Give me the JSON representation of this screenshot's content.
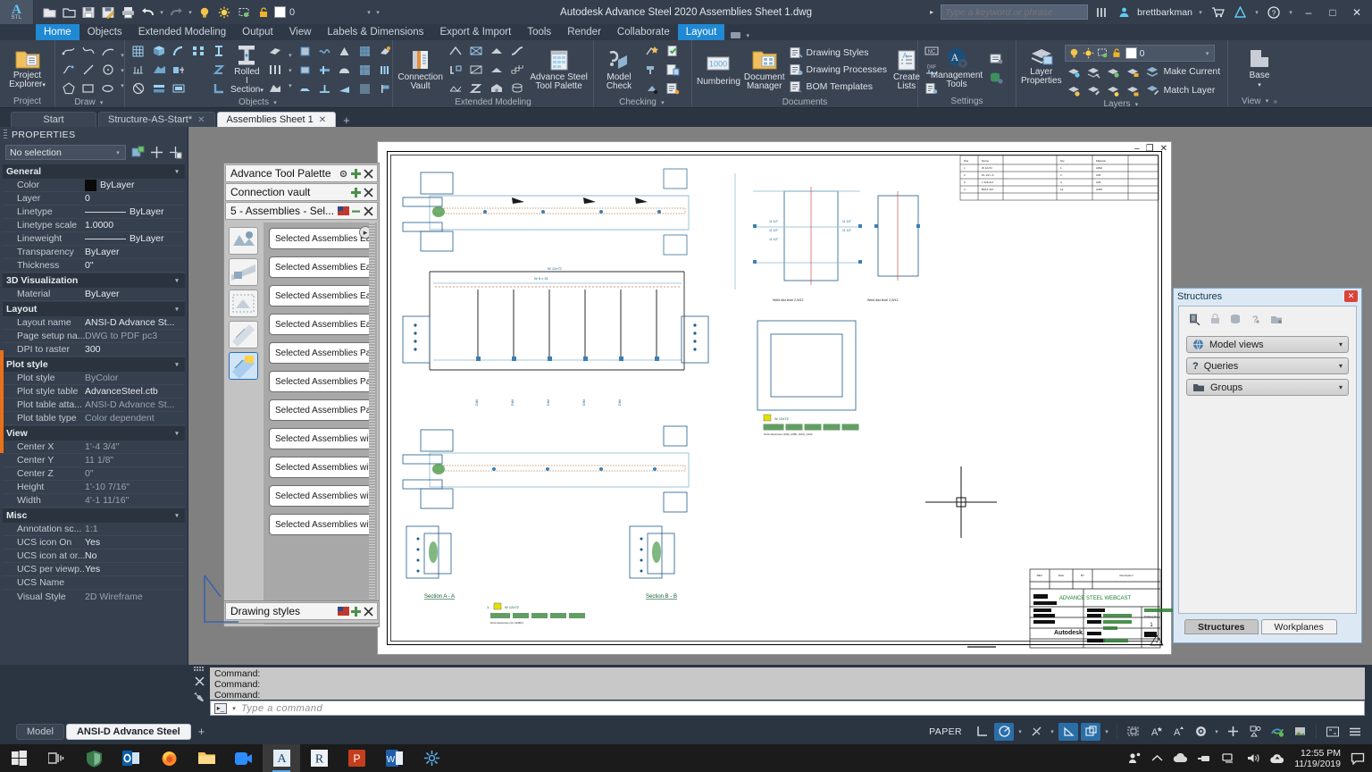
{
  "window": {
    "title": "Autodesk Advance Steel 2020   Assemblies Sheet 1.dwg",
    "app_initials": "STL",
    "search_placeholder": "Type a keyword or phrase",
    "user": "brettbarkman",
    "layer_current": "0",
    "min_label": "–",
    "max_label": "□",
    "close_label": "✕"
  },
  "ribbon": {
    "tabs": [
      {
        "label": "Home",
        "active": true
      },
      {
        "label": "Objects",
        "active": false
      },
      {
        "label": "Extended Modeling",
        "active": false
      },
      {
        "label": "Output",
        "active": false
      },
      {
        "label": "View",
        "active": false
      },
      {
        "label": "Labels & Dimensions",
        "active": false
      },
      {
        "label": "Export & Import",
        "active": false
      },
      {
        "label": "Tools",
        "active": false
      },
      {
        "label": "Render",
        "active": false
      },
      {
        "label": "Collaborate",
        "active": false
      },
      {
        "label": "Layout",
        "active": true
      }
    ],
    "panels": [
      {
        "title": "Project",
        "big": [
          {
            "label": "Project\nExplorer"
          }
        ]
      },
      {
        "title": "Draw"
      },
      {
        "title": "Objects",
        "big": [
          {
            "label": "Rolled\nI Section"
          }
        ]
      },
      {
        "title": "Extended Modeling",
        "big": [
          {
            "label": "Connection\nVault"
          },
          {
            "label": "Advance Steel\nTool Palette"
          }
        ]
      },
      {
        "title": "Checking",
        "big": [
          {
            "label": "Model\nCheck"
          }
        ]
      },
      {
        "title": "Documents",
        "big": [
          {
            "label": "Numbering"
          },
          {
            "label": "Document\nManager"
          },
          {
            "label": "Create\nLists"
          }
        ],
        "rows": [
          "Drawing Styles",
          "Drawing Processes",
          "BOM Templates"
        ]
      },
      {
        "title": "Settings",
        "big": [
          {
            "label": "Management\nTools"
          }
        ]
      },
      {
        "title": "Layers",
        "big": [
          {
            "label": "Layer\nProperties"
          }
        ],
        "rows": [
          "Make Current",
          "Match Layer"
        ]
      },
      {
        "title": "View",
        "big": [
          {
            "label": "Base"
          }
        ]
      }
    ]
  },
  "doc_tabs": [
    {
      "label": "Start",
      "active": false,
      "closable": false
    },
    {
      "label": "Structure-AS-Start*",
      "active": false,
      "closable": true
    },
    {
      "label": "Assemblies Sheet 1",
      "active": true,
      "closable": true
    }
  ],
  "properties": {
    "title": "PROPERTIES",
    "selection": "No selection",
    "groups": [
      {
        "name": "General",
        "rows": [
          {
            "key": "Color",
            "value": "ByLayer",
            "swatch": "#0a0a0a"
          },
          {
            "key": "Layer",
            "value": "0"
          },
          {
            "key": "Linetype",
            "value": "ByLayer",
            "line": true
          },
          {
            "key": "Linetype scale",
            "value": "1.0000"
          },
          {
            "key": "Lineweight",
            "value": "ByLayer",
            "line": true
          },
          {
            "key": "Transparency",
            "value": "ByLayer"
          },
          {
            "key": "Thickness",
            "value": "0\""
          }
        ]
      },
      {
        "name": "3D Visualization",
        "rows": [
          {
            "key": "Material",
            "value": "ByLayer"
          }
        ]
      },
      {
        "name": "Layout",
        "rows": [
          {
            "key": "Layout name",
            "value": "ANSI-D Advance St..."
          },
          {
            "key": "Page setup na...",
            "value": "DWG to PDF pc3",
            "dim": true
          },
          {
            "key": "DPI to raster",
            "value": "300"
          }
        ]
      },
      {
        "name": "Plot style",
        "rows": [
          {
            "key": "Plot style",
            "value": "ByColor",
            "dim": true
          },
          {
            "key": "Plot style table",
            "value": "AdvanceSteel.ctb"
          },
          {
            "key": "Plot table atta...",
            "value": "ANSI-D Advance St...",
            "dim": true
          },
          {
            "key": "Plot table type",
            "value": "Color dependent",
            "dim": true
          }
        ]
      },
      {
        "name": "View",
        "rows": [
          {
            "key": "Center X",
            "value": "1'-4 3/4\"",
            "dim": true
          },
          {
            "key": "Center Y",
            "value": "11 1/8\"",
            "dim": true
          },
          {
            "key": "Center Z",
            "value": "0\"",
            "dim": true
          },
          {
            "key": "Height",
            "value": "1'-10 7/16\"",
            "dim": true
          },
          {
            "key": "Width",
            "value": "4'-1 11/16\"",
            "dim": true
          }
        ]
      },
      {
        "name": "Misc",
        "rows": [
          {
            "key": "Annotation sc...",
            "value": "1:1",
            "dim": true
          },
          {
            "key": "UCS icon On",
            "value": "Yes"
          },
          {
            "key": "UCS icon at or...",
            "value": "No"
          },
          {
            "key": "UCS per viewp...",
            "value": "Yes"
          },
          {
            "key": "UCS Name",
            "value": ""
          },
          {
            "key": "Visual Style",
            "value": "2D Wireframe",
            "dim": true
          }
        ]
      }
    ]
  },
  "tool_palette": {
    "titles": [
      {
        "label": "Advance Tool Palette",
        "icons": [
          "gear-icon",
          "move-icon",
          "close-icon"
        ]
      },
      {
        "label": "Connection vault",
        "icons": [
          "move-icon",
          "close-icon"
        ]
      },
      {
        "label": "5 - Assemblies - Sel...",
        "icons": [
          "flag-icon",
          "minimize-icon",
          "close-icon"
        ]
      }
    ],
    "items": [
      "Selected Assemblies Ea...",
      "Selected Assemblies Each AN...",
      "Selected Assemblies Each AN...",
      "Selected Assemblies Each AN...",
      "Selected Assemblies PageF...",
      "Selected Assemblies PageF...",
      "Selected Assemblies PageF...",
      "Selected Assemblies with Par...",
      "Selected Assemblies with Par...",
      "Selected Assemblies with Par...",
      "Selected Assemblies with Par..."
    ],
    "drawing_styles_label": "Drawing styles"
  },
  "structures": {
    "title": "Structures",
    "close_label": "✕",
    "bars": [
      {
        "label": "Model views",
        "icon": "globe-icon"
      },
      {
        "label": "Queries",
        "icon": "question-icon"
      },
      {
        "label": "Groups",
        "icon": "folder-icon"
      }
    ],
    "tabs": [
      {
        "label": "Structures",
        "active": true
      },
      {
        "label": "Workplanes",
        "active": false
      }
    ]
  },
  "drawing": {
    "title_block": {
      "rev_headers": [
        "REV.",
        "Date",
        "BY",
        "Description"
      ],
      "project_title": "ADVANCE STEEL WEBCAST",
      "brand": "Autodesk.",
      "drawing_no_label": "Drawing No. :",
      "drawing_no": "1"
    },
    "section_labels": [
      "Section A - A",
      "Section B - B"
    ]
  },
  "command_line": {
    "history": [
      "Command:",
      "Command:",
      "Command:"
    ],
    "placeholder": "Type a command"
  },
  "status_bar": {
    "layout_tabs": [
      {
        "label": "Model",
        "active": false
      },
      {
        "label": "ANSI-D Advance Steel",
        "active": true
      }
    ],
    "add_label": "+",
    "space_label": "PAPER"
  },
  "taskbar": {
    "icons": [
      "start-icon",
      "task-view-icon",
      "defender-icon",
      "outlook-icon",
      "firefox-icon",
      "explorer-icon",
      "zoom-icon",
      "autocad-icon",
      "revit-icon",
      "powerpoint-icon",
      "word-icon",
      "app-icon"
    ],
    "tray": [
      "people-icon",
      "chevron-up-icon",
      "onedrive-cloud-icon",
      "usb-icon",
      "network-icon",
      "volume-icon",
      "sync-icon"
    ],
    "time": "12:55 PM",
    "date": "11/19/2019",
    "action_center": "notifications-icon"
  }
}
